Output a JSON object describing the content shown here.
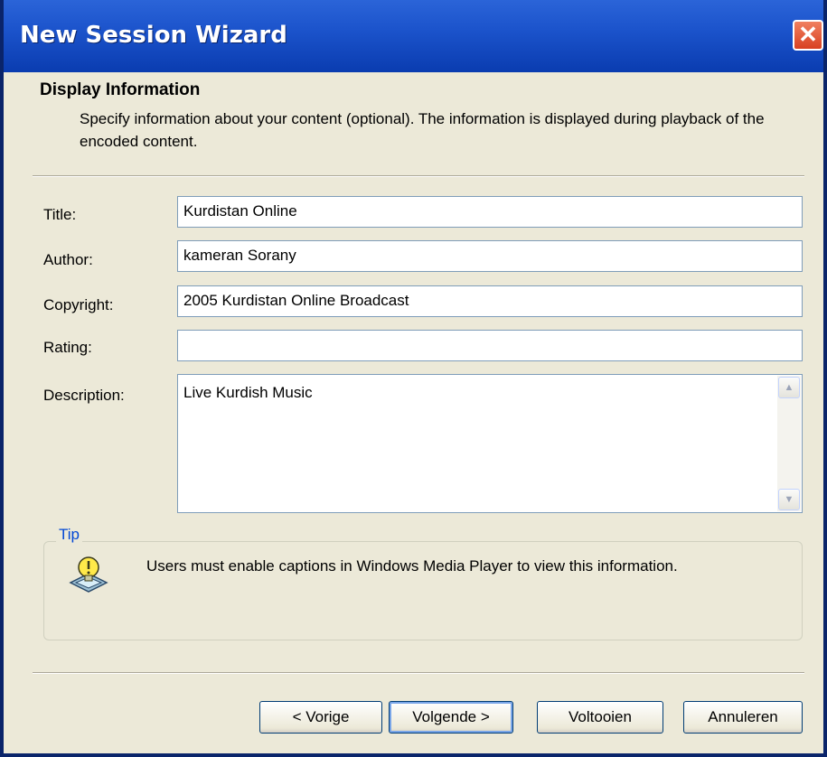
{
  "window": {
    "title": "New Session Wizard",
    "close_glyph": "✕"
  },
  "header": {
    "title": "Display Information",
    "description": "Specify information about your content (optional). The information is displayed during playback of the encoded content."
  },
  "form": {
    "title_label": "Title:",
    "title_value": "Kurdistan Online",
    "author_label": "Author:",
    "author_value": "kameran Sorany",
    "copyright_label": "Copyright:",
    "copyright_value": "2005 Kurdistan Online Broadcast",
    "rating_label": "Rating:",
    "rating_value": "",
    "description_label": "Description:",
    "description_value": "Live Kurdish Music"
  },
  "tip": {
    "legend": "Tip",
    "text": "Users must enable captions in Windows Media Player to view this information.",
    "icon": "lightbulb-icon"
  },
  "buttons": {
    "back": "< Vorige",
    "next": "Volgende >",
    "finish": "Voltooien",
    "cancel": "Annuleren"
  },
  "colors": {
    "titlebar": "#0a3cb0",
    "window_bg": "#ece9d8",
    "tip_legend": "#0046d5",
    "close": "#d84020"
  }
}
